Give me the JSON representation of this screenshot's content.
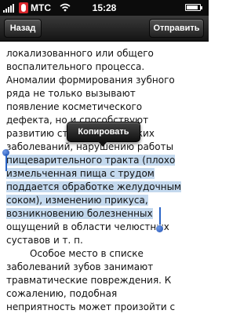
{
  "status_bar": {
    "carrier": "МТС",
    "time": "15:28",
    "battery_level": 0.85
  },
  "nav": {
    "back_label": "Назад",
    "send_label": "Отправить"
  },
  "popup": {
    "copy_label": "Копировать"
  },
  "selection_color": "#c4d9ee",
  "text": {
    "p1_lines": [
      "локализованного или общего",
      "воспалительного процесса.",
      "Аномалии формирования зубного",
      "ряда не только вызывают",
      "появление косметического",
      "дефекта, но и способствуют",
      "развитию стоматологических",
      "заболеваний, нарушению работы"
    ],
    "p1_selected_lines": [
      "пищеварительного тракта (плохо",
      "измельченная пища с трудом",
      "поддается обработке желудочным",
      "соком), изменению прикуса,",
      "возникновению болезненных"
    ],
    "p1_tail_lines": [
      "ощущений в области челюстных",
      "суставов и т. п."
    ],
    "p2_lines": [
      "Особое место в списке",
      "заболеваний зубов занимают",
      "травматические повреждения. К",
      "сожалению, подобная",
      "неприятность может произойти с"
    ]
  }
}
